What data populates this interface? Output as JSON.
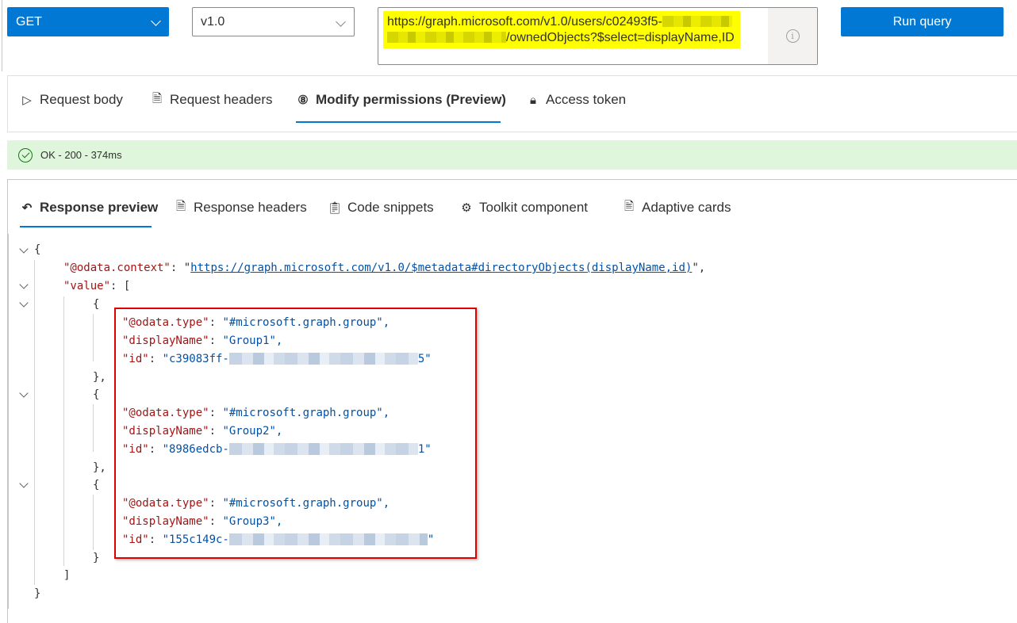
{
  "request": {
    "method": "GET",
    "version": "v1.0",
    "url_prefix": "https://graph.microsoft.com/v1.0/users/c02493f5-",
    "url_suffix": "/ownedObjects?$select=displayName,ID",
    "url_redacted": true,
    "run_label": "Run query",
    "info_icon": "info-icon"
  },
  "request_tabs": [
    {
      "label": "Request body",
      "icon": "send-icon",
      "active": false
    },
    {
      "label": "Request headers",
      "icon": "document-icon",
      "active": false
    },
    {
      "label": "Modify permissions (Preview)",
      "icon": "permissions-icon",
      "active": true
    },
    {
      "label": "Access token",
      "icon": "lock-icon",
      "active": false
    }
  ],
  "status": {
    "text": "OK - 200 - 374ms",
    "icon": "check-circle-icon",
    "color": "#107c10",
    "background": "#dff6dd"
  },
  "response_tabs": [
    {
      "label": "Response preview",
      "icon": "undo-icon",
      "active": true
    },
    {
      "label": "Response headers",
      "icon": "document-icon",
      "active": false
    },
    {
      "label": "Code snippets",
      "icon": "clipboard-code-icon",
      "active": false
    },
    {
      "label": "Toolkit component",
      "icon": "toolkit-icon",
      "active": false
    },
    {
      "label": "Adaptive cards",
      "icon": "card-icon",
      "active": false
    }
  ],
  "response": {
    "open_brace": "{",
    "close_brace": "}",
    "context_key": "\"@odata.context\"",
    "context_value": "https://graph.microsoft.com/v1.0/$metadata#directoryObjects(displayName,id)",
    "value_key": "\"value\"",
    "open_bracket": "[",
    "close_bracket": "]",
    "items": [
      {
        "type_key": "\"@odata.type\"",
        "type_value": "\"#microsoft.graph.group\",",
        "name_key": "\"displayName\"",
        "name_value": "\"Group1\",",
        "id_key": "\"id\"",
        "id_prefix": "\"c39083ff-",
        "id_suffix": "5\"",
        "close": "},"
      },
      {
        "type_key": "\"@odata.type\"",
        "type_value": "\"#microsoft.graph.group\",",
        "name_key": "\"displayName\"",
        "name_value": "\"Group2\",",
        "id_key": "\"id\"",
        "id_prefix": "\"8986edcb-",
        "id_suffix": "1\"",
        "close": "},"
      },
      {
        "type_key": "\"@odata.type\"",
        "type_value": "\"#microsoft.graph.group\",",
        "name_key": "\"displayName\"",
        "name_value": "\"Group3\",",
        "id_key": "\"id\"",
        "id_prefix": "\"155c149c-",
        "id_suffix": "\"",
        "close": "}"
      }
    ]
  },
  "colors": {
    "accent": "#0078d4",
    "url_highlight": "#ffff00",
    "annotation_box": "#e00000",
    "json_key": "#a31515",
    "json_string": "#0451a5"
  }
}
